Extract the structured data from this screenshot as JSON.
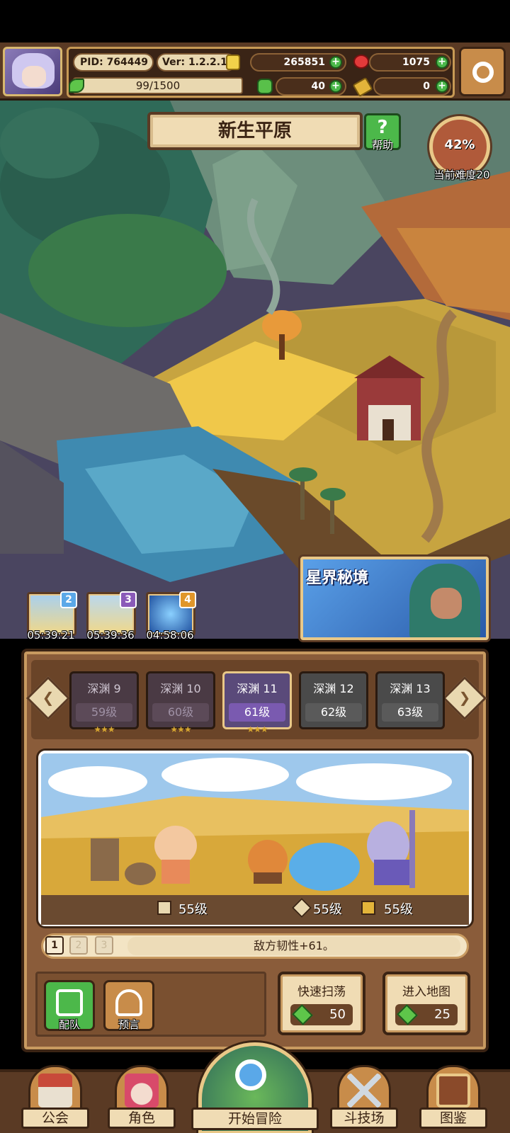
{
  "header": {
    "pid": "PID: 764449",
    "version": "Ver: 1.2.2.1",
    "gold": "265851",
    "ruby": "1075",
    "stamina": "99/1500",
    "clover": "40",
    "ticket": "0",
    "plus": "+"
  },
  "map": {
    "area_title": "新生平原",
    "help_label": "帮助",
    "help_symbol": "?",
    "difficulty_percent": "42%",
    "difficulty_label": "当前难度20",
    "astral_title": "星界秘境"
  },
  "timers": [
    {
      "num": "2",
      "time": "05:39:21",
      "color": "#5aa8e8"
    },
    {
      "num": "3",
      "time": "05:39:36",
      "color": "#8a5ab8"
    },
    {
      "num": "4",
      "time": "04:58:06",
      "color": "#e0962a"
    }
  ],
  "stages": [
    {
      "name": "深渊 9",
      "level": "59级",
      "stars": "★★★"
    },
    {
      "name": "深渊 10",
      "level": "60级",
      "stars": "★★★"
    },
    {
      "name": "深渊 11",
      "level": "61级",
      "stars": "★★★"
    },
    {
      "name": "深渊 12",
      "level": "62级",
      "stars": ""
    },
    {
      "name": "深渊 13",
      "level": "63级",
      "stars": ""
    }
  ],
  "scene": {
    "stat1": "55级",
    "stat2": "55级",
    "stat3": "55级"
  },
  "pages": [
    "1",
    "2",
    "3"
  ],
  "effect_text": "敌方韧性+61。",
  "buttons": {
    "team": "配队",
    "prophecy": "预言",
    "quick_sweep": "快速扫荡",
    "quick_sweep_cost": "50",
    "enter_map": "进入地图",
    "enter_map_cost": "25"
  },
  "nav": {
    "guild": "公会",
    "character": "角色",
    "start": "开始冒险",
    "arena": "斗技场",
    "codex": "图鉴"
  },
  "colors": {
    "panel_brown": "#8a5c3a",
    "frame_gold": "#e9c888",
    "accent_green": "#4bb84a"
  }
}
